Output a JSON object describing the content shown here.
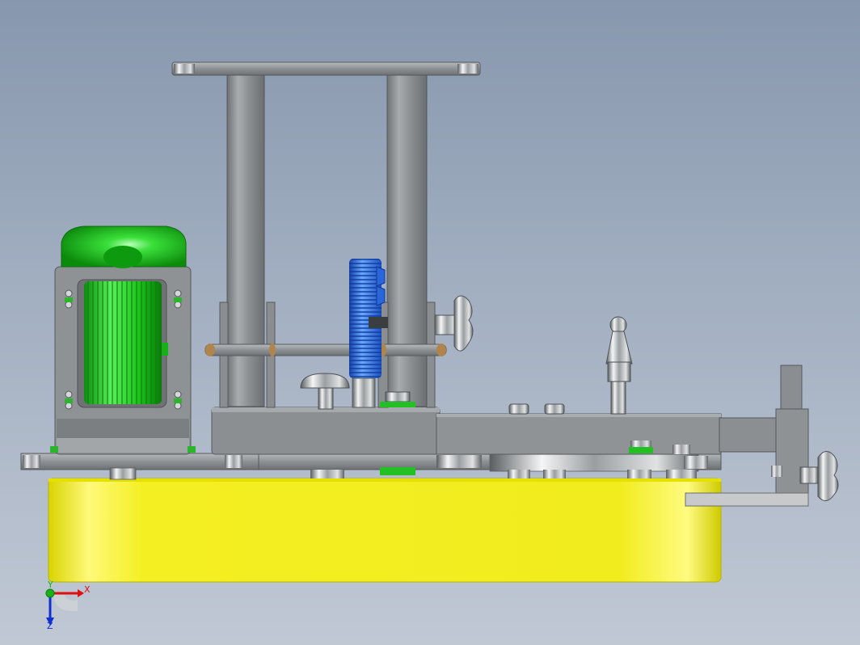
{
  "viewport": {
    "background_top": "#8797ad",
    "background_bottom": "#c0c8d4"
  },
  "model": {
    "colors": {
      "base_plate": "#f2ee22",
      "motor": "#22cc22",
      "lead_screw": "#2e6fe0",
      "steel": "#8f9396",
      "steel_light": "#c8cacc"
    }
  },
  "triad": {
    "x_label": "X",
    "y_label": "Y",
    "z_label": "Z",
    "x_color": "#e01010",
    "y_color": "#16b416",
    "z_color": "#1030d0"
  }
}
